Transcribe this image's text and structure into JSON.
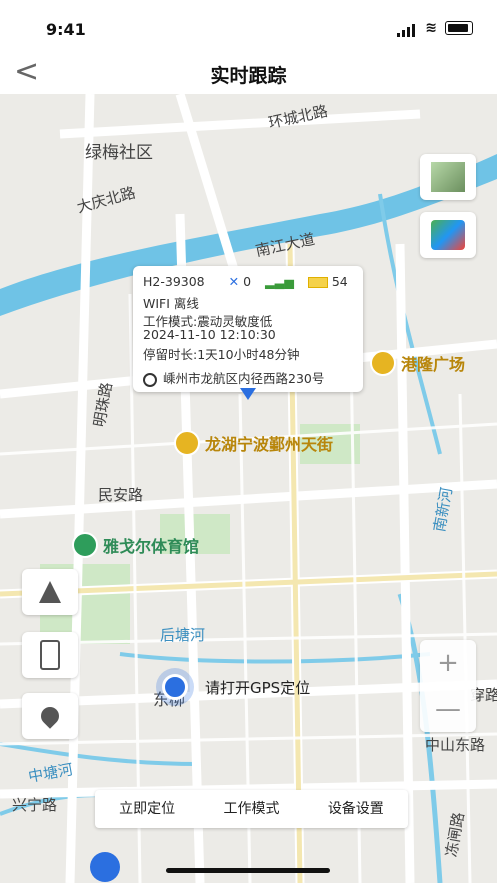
{
  "status": {
    "time": "9:41"
  },
  "nav": {
    "back": "<",
    "title": "实时跟踪"
  },
  "map": {
    "labels": [
      "绿梅社区",
      "大庆北路",
      "环城北路",
      "南江大道",
      "明珠路",
      "民安路",
      "后塘河",
      "东柳",
      "兴宁路",
      "中塘河",
      "中山东路",
      "南新河",
      "穿路",
      "冻闸路"
    ],
    "pois": {
      "gl": "港隆广场",
      "lh": "龙湖宁波鄞州天街",
      "yg": "雅戈尔体育馆"
    },
    "gps_tip": "请打开GPS定位"
  },
  "popup": {
    "device": "H2-39308",
    "sat": "0",
    "battery": "54",
    "line1": "WIFI 离线",
    "line2": "工作模式:震动灵敏度低",
    "line3": "2024-11-10 12:10:30",
    "line4": "停留时长:1天10小时48分钟",
    "address": "嵊州市龙航区内径西路230号"
  },
  "zoom": {
    "plus": "+",
    "minus": "—"
  },
  "toolbar": {
    "locate": "立即定位",
    "mode": "工作模式",
    "settings": "设备设置"
  },
  "colors": {
    "water": "#6fc3e6",
    "road": "#ffffff",
    "accent": "#2b6fe0"
  }
}
